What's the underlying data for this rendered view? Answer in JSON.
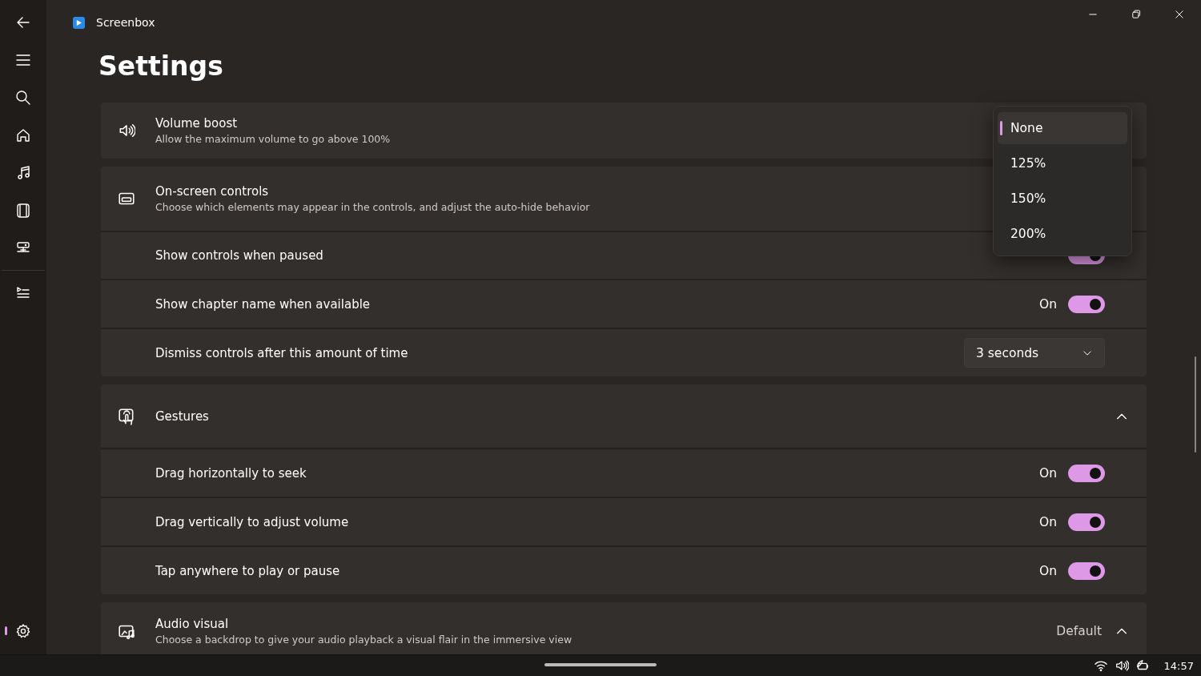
{
  "app": {
    "title": "Screenbox"
  },
  "nav_items": [
    {
      "selected": false
    },
    {
      "selected": false
    },
    {
      "selected": false
    },
    {
      "selected": false
    },
    {
      "selected": false
    },
    {
      "selected": false
    },
    {
      "selected": false
    },
    {
      "selected": false
    },
    {
      "selected": true
    }
  ],
  "page_title": "Settings",
  "sections": [
    {
      "kind": "setting",
      "title": "Volume boost",
      "description": "Allow the maximum volume to go above 100%"
    },
    {
      "kind": "group",
      "title": "On-screen controls",
      "description": "Choose which elements may appear in the controls, and adjust the auto-hide behavior",
      "rows": [
        {
          "kind": "toggle",
          "label": "Show controls when paused",
          "on": true
        },
        {
          "kind": "toggle",
          "label": "Show chapter name when available",
          "on": true,
          "state_text": "On"
        },
        {
          "kind": "dropdown",
          "label": "Dismiss controls after this amount of time",
          "value": "3 seconds"
        }
      ]
    },
    {
      "kind": "group",
      "title": "Gestures",
      "expanded": true,
      "rows": [
        {
          "kind": "toggle",
          "label": "Drag horizontally to seek",
          "on": true,
          "state_text": "On"
        },
        {
          "kind": "toggle",
          "label": "Drag vertically to adjust volume",
          "on": true,
          "state_text": "On"
        },
        {
          "kind": "toggle",
          "label": "Tap anywhere to play or pause",
          "on": true,
          "state_text": "On"
        }
      ]
    },
    {
      "kind": "setting",
      "title": "Audio visual",
      "description": "Choose a backdrop to give your audio playback a visual flair in the immersive view",
      "value": "Default",
      "expanded": true
    }
  ],
  "dropdown_menu": {
    "options": [
      {
        "label": "None",
        "selected": true
      },
      {
        "label": "125%",
        "selected": false
      },
      {
        "label": "150%",
        "selected": false
      },
      {
        "label": "200%",
        "selected": false
      }
    ]
  },
  "taskbar": {
    "time": "14:57"
  }
}
